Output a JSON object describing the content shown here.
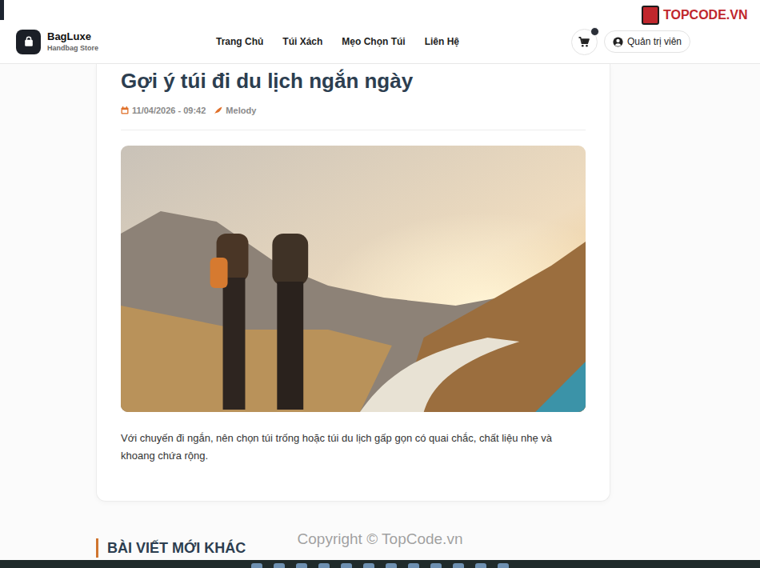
{
  "brand": {
    "name": "BagLuxe",
    "tagline": "Handbag Store"
  },
  "nav": [
    "Trang Chủ",
    "Túi Xách",
    "Mẹo Chọn Túi",
    "Liên Hệ"
  ],
  "cart": {
    "badge_visible": true
  },
  "user": {
    "label": "Quản trị viên"
  },
  "article": {
    "title": "Gợi ý túi đi du lịch ngắn ngày",
    "date": "11/04/2026 - 09:42",
    "author": "Melody",
    "body": "Với chuyến đi ngắn, nên chọn túi trống hoặc túi du lịch gấp gọn có quai chắc, chất liệu nhẹ và khoang chứa rộng."
  },
  "related": {
    "heading": "BÀI VIẾT MỚI KHÁC"
  },
  "watermarks": {
    "logo": "TOPCODE.VN",
    "footer": "Copyright © TopCode.vn"
  }
}
